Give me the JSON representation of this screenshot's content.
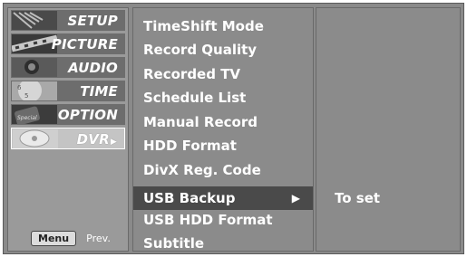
{
  "categories": [
    {
      "label": "SETUP",
      "icon": "satellite-dish-icon"
    },
    {
      "label": "PICTURE",
      "icon": "film-strip-icon"
    },
    {
      "label": "AUDIO",
      "icon": "speaker-icon"
    },
    {
      "label": "TIME",
      "icon": "clock-icon"
    },
    {
      "label": "OPTION",
      "icon": "special-icon"
    },
    {
      "label": "DVR",
      "icon": "disc-icon",
      "active": true
    }
  ],
  "menu_items": [
    {
      "label": "TimeShift Mode"
    },
    {
      "label": "Record Quality"
    },
    {
      "label": "Recorded TV"
    },
    {
      "label": "Schedule List"
    },
    {
      "label": "Manual Record"
    },
    {
      "label": "HDD Format"
    },
    {
      "label": "DivX Reg. Code"
    },
    {
      "label": "USB Backup",
      "selected": true
    },
    {
      "label": "USB HDD Format"
    },
    {
      "label": "Subtitle"
    }
  ],
  "selected_value": "To set",
  "footer": {
    "key": "Menu",
    "text": "Prev."
  },
  "arrow_symbol": "▶",
  "colors": {
    "panel": "#8b8b8b",
    "highlight": "#4a4a4a",
    "active_category": "#c4c4c4",
    "text": "#ffffff"
  }
}
